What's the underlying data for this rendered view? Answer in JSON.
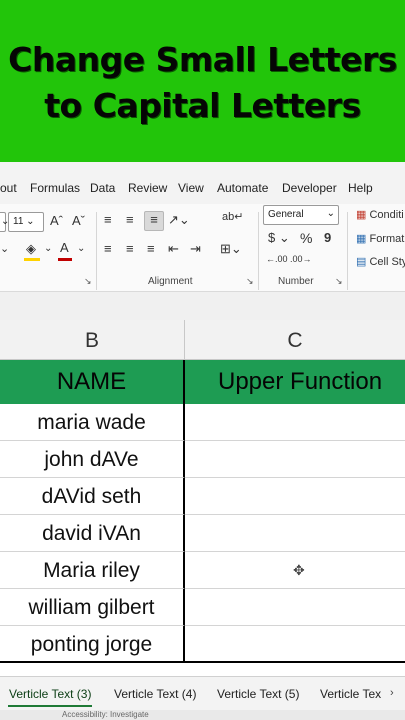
{
  "banner": {
    "line1": "Change Small Letters",
    "line2": "to Capital Letters"
  },
  "menu": [
    "out",
    "Formulas",
    "Data",
    "Review",
    "View",
    "Automate",
    "Developer",
    "Help"
  ],
  "ribbon": {
    "font_size": "11",
    "font_grow": "A^",
    "font_shrink": "A˅",
    "alignment_label": "Alignment",
    "number_label": "Number",
    "number_format": "General",
    "currency": "$",
    "percent": "%",
    "comma": "9",
    "increase_decimal": ".00",
    "decrease_decimal": ".00",
    "conditional": "Conditi",
    "format_table": "Format",
    "cell_styles": "Cell Styl",
    "wrap": "ab",
    "accent_font": "#c00000",
    "accent_fill": "#ffd200"
  },
  "sheet": {
    "col_b": "B",
    "col_c": "C",
    "header_b": "NAME",
    "header_c": "Upper Function",
    "header_color": "#1e9c53",
    "rows": [
      "maria wade",
      "john dAVe",
      "dAVid seth",
      "david iVAn",
      "Maria riley",
      "william gilbert",
      "ponting jorge"
    ]
  },
  "tabs": [
    "Verticle Text (3)",
    "Verticle Text (4)",
    "Verticle Text (5)",
    "Verticle Tex"
  ],
  "status": "Accessibility: Investigate"
}
